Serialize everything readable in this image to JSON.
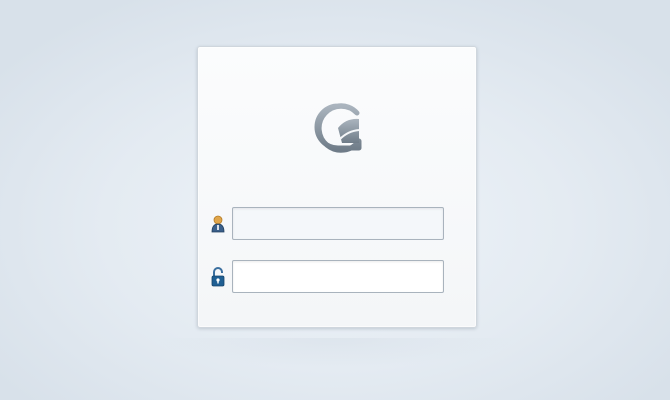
{
  "login": {
    "username": {
      "value": "",
      "placeholder": "",
      "icon": "user-icon"
    },
    "password": {
      "value": "",
      "placeholder": "",
      "icon": "padlock-open-icon"
    }
  },
  "brand": {
    "logo": "brand-logo-icon",
    "logo_color": "#7d8a96"
  }
}
